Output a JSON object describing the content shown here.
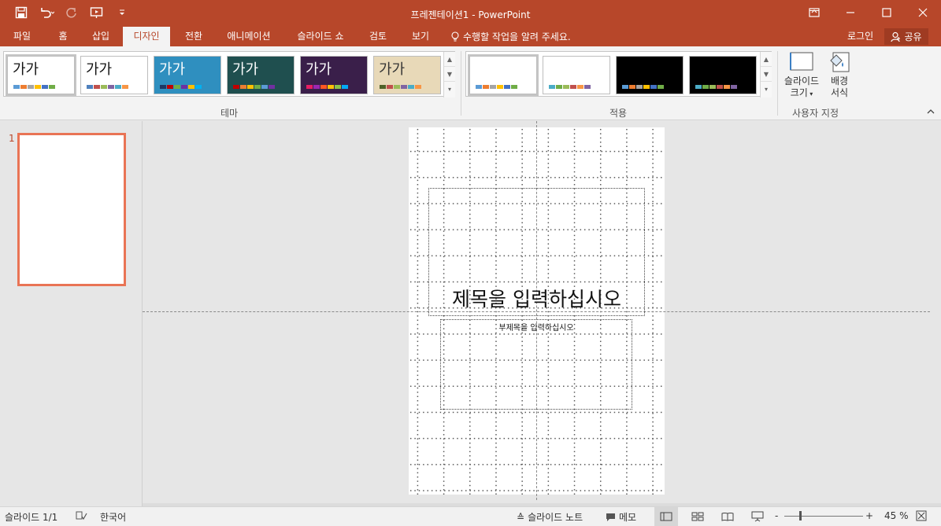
{
  "app": {
    "title": "프레젠테이션1 - PowerPoint"
  },
  "qat": {
    "save_icon": "save-icon",
    "undo_icon": "undo-icon",
    "redo_icon": "redo-icon",
    "present_icon": "start-from-beginning-icon",
    "customize_icon": "customize-qat-icon"
  },
  "tabs": [
    {
      "label": "파일"
    },
    {
      "label": "홈"
    },
    {
      "label": "삽입"
    },
    {
      "label": "디자인"
    },
    {
      "label": "전환"
    },
    {
      "label": "애니메이션"
    },
    {
      "label": "슬라이드 쇼"
    },
    {
      "label": "검토"
    },
    {
      "label": "보기"
    }
  ],
  "active_tab": "디자인",
  "tell_me": "수행할 작업을 알려 주세요.",
  "account": {
    "login": "로그인",
    "share": "공유"
  },
  "ribbon": {
    "themes": {
      "group_label": "테마",
      "items": [
        {
          "text": "가가",
          "bg": "#ffffff",
          "fg": "#111111",
          "swatches": [
            "#5b9bd5",
            "#ed7d31",
            "#a5a5a5",
            "#ffc000",
            "#4472c4",
            "#70ad47"
          ]
        },
        {
          "text": "가가",
          "bg": "#ffffff",
          "fg": "#111111",
          "swatches": [
            "#4f81bd",
            "#c0504d",
            "#9bbb59",
            "#8064a2",
            "#4bacc6",
            "#f79646"
          ]
        },
        {
          "text": "가가",
          "bg": "#2f8fbf",
          "fg": "#ffffff",
          "swatches": [
            "#1f3864",
            "#c00000",
            "#70ad47",
            "#7030a0",
            "#ffc000",
            "#00b0f0"
          ]
        },
        {
          "text": "가가",
          "bg": "#1f4f4f",
          "fg": "#ffffff",
          "swatches": [
            "#c00000",
            "#ed7d31",
            "#ffc000",
            "#70ad47",
            "#5b9bd5",
            "#7030a0"
          ]
        },
        {
          "text": "가가",
          "bg": "#3a1f4a",
          "fg": "#ffffff",
          "swatches": [
            "#e91e63",
            "#9c27b0",
            "#ff5722",
            "#ffc107",
            "#8bc34a",
            "#03a9f4"
          ]
        },
        {
          "text": "가가",
          "bg": "#e8d9b8",
          "fg": "#333333",
          "swatches": [
            "#4f6228",
            "#c0504d",
            "#9bbb59",
            "#8064a2",
            "#4bacc6",
            "#f79646"
          ]
        }
      ]
    },
    "variants": {
      "group_label": "적용",
      "items": [
        {
          "bg": "#ffffff",
          "swatches": [
            "#5b9bd5",
            "#ed7d31",
            "#a5a5a5",
            "#ffc000",
            "#4472c4",
            "#70ad47"
          ]
        },
        {
          "bg": "#ffffff",
          "swatches": [
            "#4bacc6",
            "#70ad47",
            "#9bbb59",
            "#c0504d",
            "#f79646",
            "#8064a2"
          ]
        },
        {
          "bg": "#000000",
          "swatches": [
            "#5b9bd5",
            "#ed7d31",
            "#a5a5a5",
            "#ffc000",
            "#4472c4",
            "#70ad47"
          ]
        },
        {
          "bg": "#000000",
          "swatches": [
            "#4bacc6",
            "#70ad47",
            "#9bbb59",
            "#c0504d",
            "#f79646",
            "#8064a2"
          ]
        }
      ]
    },
    "customize": {
      "group_label": "사용자 지정",
      "slide_size_line1": "슬라이드",
      "slide_size_line2": "크기",
      "bg_format_line1": "배경",
      "bg_format_line2": "서식"
    }
  },
  "thumbnails": {
    "slide_number": "1"
  },
  "slide": {
    "title_placeholder": "제목을 입력하십시오",
    "subtitle_placeholder": "부제목을 입력하십시오"
  },
  "status": {
    "slide_info": "슬라이드 1/1",
    "language": "한국어",
    "notes": "슬라이드 노트",
    "comments": "메모",
    "zoom": "45 %",
    "zoom_out": "-",
    "zoom_in": "+"
  },
  "colors": {
    "brand": "#b7472a",
    "accent_selection": "#e97455"
  }
}
